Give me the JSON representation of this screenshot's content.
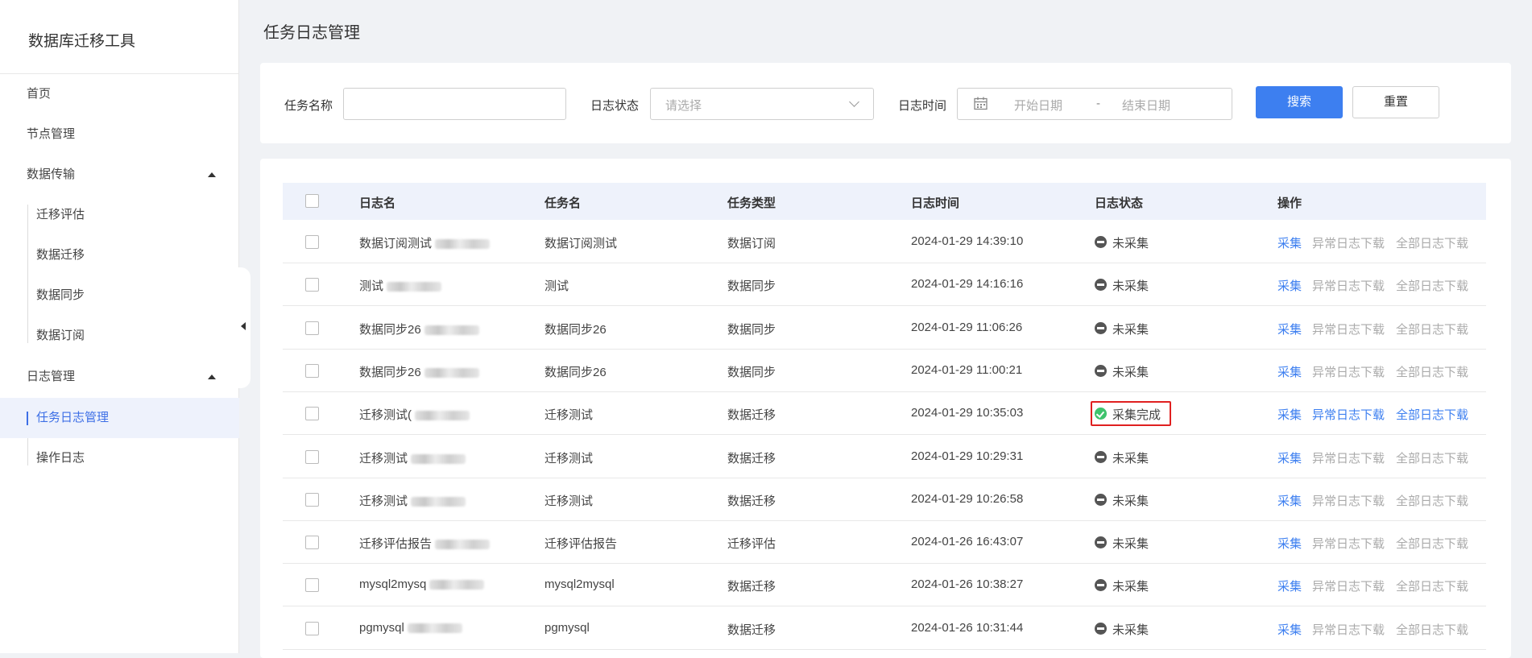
{
  "sidebar": {
    "app_title": "数据库迁移工具",
    "items": [
      {
        "label": "首页"
      },
      {
        "label": "节点管理"
      },
      {
        "label": "数据传输"
      },
      {
        "label": "迁移评估"
      },
      {
        "label": "数据迁移"
      },
      {
        "label": "数据同步"
      },
      {
        "label": "数据订阅"
      },
      {
        "label": "日志管理"
      },
      {
        "label": "任务日志管理"
      },
      {
        "label": "操作日志"
      }
    ]
  },
  "page_title": "任务日志管理",
  "filter": {
    "task_name_label": "任务名称",
    "task_name_value": "",
    "log_status_label": "日志状态",
    "log_status_placeholder": "请选择",
    "log_time_label": "日志时间",
    "start_date_placeholder": "开始日期",
    "date_separator": "-",
    "end_date_placeholder": "结束日期",
    "search_button": "搜索",
    "reset_button": "重置"
  },
  "table": {
    "headers": [
      "日志名",
      "任务名",
      "任务类型",
      "日志时间",
      "日志状态",
      "操作"
    ],
    "actions": [
      "采集",
      "异常日志下载",
      "全部日志下载"
    ],
    "rows": [
      {
        "log_name": "数据订阅测试",
        "task_name": "数据订阅测试",
        "task_type": "数据订阅",
        "time": "2024-01-29 14:39:10",
        "status": "未采集",
        "done": false
      },
      {
        "log_name": "测试",
        "task_name": "测试",
        "task_type": "数据同步",
        "time": "2024-01-29 14:16:16",
        "status": "未采集",
        "done": false
      },
      {
        "log_name": "数据同步26",
        "task_name": "数据同步26",
        "task_type": "数据同步",
        "time": "2024-01-29 11:06:26",
        "status": "未采集",
        "done": false
      },
      {
        "log_name": "数据同步26",
        "task_name": "数据同步26",
        "task_type": "数据同步",
        "time": "2024-01-29 11:00:21",
        "status": "未采集",
        "done": false
      },
      {
        "log_name": "迁移测试(",
        "task_name": "迁移测试",
        "task_type": "数据迁移",
        "time": "2024-01-29 10:35:03",
        "status": "采集完成",
        "done": true
      },
      {
        "log_name": "迁移测试",
        "task_name": "迁移测试",
        "task_type": "数据迁移",
        "time": "2024-01-29 10:29:31",
        "status": "未采集",
        "done": false
      },
      {
        "log_name": "迁移测试",
        "task_name": "迁移测试",
        "task_type": "数据迁移",
        "time": "2024-01-29 10:26:58",
        "status": "未采集",
        "done": false
      },
      {
        "log_name": "迁移评估报告",
        "task_name": "迁移评估报告",
        "task_type": "迁移评估",
        "time": "2024-01-26 16:43:07",
        "status": "未采集",
        "done": false
      },
      {
        "log_name": "mysql2mysq",
        "task_name": "mysql2mysql",
        "task_type": "数据迁移",
        "time": "2024-01-26 10:38:27",
        "status": "未采集",
        "done": false
      },
      {
        "log_name": "pgmysql",
        "task_name": "pgmysql",
        "task_type": "数据迁移",
        "time": "2024-01-26 10:31:44",
        "status": "未采集",
        "done": false
      }
    ]
  },
  "colors": {
    "accent": "#3d7ff0",
    "done": "#3fc36d",
    "highlight": "#e02020"
  }
}
